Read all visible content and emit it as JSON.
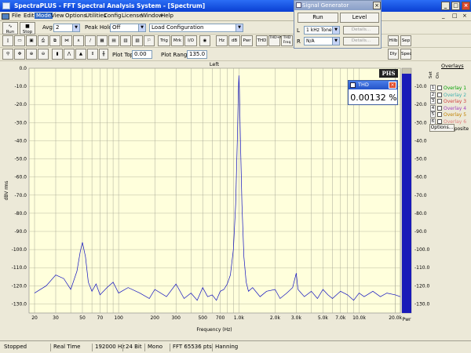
{
  "window": {
    "title": "SpectraPLUS - FFT Spectral Analysis System - [Spectrum]",
    "controls": [
      "_",
      "□",
      "×"
    ]
  },
  "menu": [
    "File",
    "Edit",
    "Mode",
    "View",
    "Options",
    "Utilities",
    "Config",
    "License",
    "Window",
    "Help"
  ],
  "toolbar": {
    "run_label": "Run",
    "stop_label": "Stop",
    "avg_label": "Avg:",
    "avg_value": "2",
    "peak_hold_label": "Peak Hold:",
    "peak_hold_value": "Off",
    "load_config_value": "Load Configuration",
    "buttons_row2": [
      "Trig",
      "Mrk",
      "I/O",
      "Hz",
      "dB",
      "Pwr",
      "THD",
      "THD+N",
      "THD Freq"
    ],
    "plot_top_label": "Plot Top:",
    "plot_top_value": "0.00",
    "plot_range_label": "Plot Range:",
    "plot_range_value": "135.0",
    "right_buttons": [
      "Hilb",
      "Sep"
    ],
    "right_buttons_row2": [
      "Dly",
      "Spec"
    ]
  },
  "signal_generator": {
    "title": "Signal Generator",
    "run_label": "Run",
    "level_label": "Level",
    "left_label": "L",
    "left_value": "1 kHz Tone",
    "right_label": "R",
    "right_value": "N/A",
    "details_label": "Details..."
  },
  "chart_title": "Left",
  "thd": {
    "title": "THD",
    "value": "0.00132 %"
  },
  "phs_label": "PHS",
  "overlays": {
    "title": "Overlays",
    "set_label": "Set",
    "on_label": "On",
    "items": [
      {
        "num": "1",
        "label": "Overlay 1",
        "color": "#00a000"
      },
      {
        "num": "2",
        "label": "Overlay 2",
        "color": "#40b0b0"
      },
      {
        "num": "3",
        "label": "Overlay 3",
        "color": "#d04040"
      },
      {
        "num": "4",
        "label": "Overlay 4",
        "color": "#a040c0"
      },
      {
        "num": "5",
        "label": "Overlay 5",
        "color": "#c08000"
      },
      {
        "num": "6",
        "label": "Overlay 6",
        "color": "#e08080"
      },
      {
        "num": "C",
        "label": "Composite",
        "color": "#000000"
      }
    ],
    "options_label": "Options..."
  },
  "right_scale": [
    "-10.0",
    "-20.0",
    "-30.0",
    "-40.0",
    "-50.0",
    "-60.0",
    "-70.0",
    "-80.0",
    "-90.0",
    "-100.0",
    "-110.0",
    "-120.0",
    "-130.0"
  ],
  "pwr_label": "Pwr",
  "status": [
    "Stopped",
    "Real Time",
    "192000 Hz",
    "24 Bit",
    "Mono",
    "FFT 65536 pts",
    "Hanning"
  ],
  "chart_data": {
    "type": "line",
    "title": "Left",
    "xlabel": "Frequency (Hz)",
    "ylabel": "dBV rms",
    "x_scale": "log",
    "xlim": [
      18,
      22000
    ],
    "ylim": [
      -135,
      0
    ],
    "y_ticks": [
      0,
      -10,
      -20,
      -30,
      -40,
      -50,
      -60,
      -70,
      -80,
      -90,
      -100,
      -110,
      -120,
      -130
    ],
    "y_tick_labels": [
      "0.0",
      "-10.0",
      "-20.0",
      "-30.0",
      "-40.0",
      "-50.0",
      "-60.0",
      "-70.0",
      "-80.0",
      "-90.0",
      "-100.0",
      "-110.0",
      "-120.0",
      "-130.0"
    ],
    "x_tick_labels": [
      {
        "v": 20,
        "t": "20"
      },
      {
        "v": 30,
        "t": "30"
      },
      {
        "v": 50,
        "t": "50"
      },
      {
        "v": 70,
        "t": "70"
      },
      {
        "v": 100,
        "t": "100"
      },
      {
        "v": 200,
        "t": "200"
      },
      {
        "v": 300,
        "t": "300"
      },
      {
        "v": 500,
        "t": "500"
      },
      {
        "v": 700,
        "t": "700"
      },
      {
        "v": 1000,
        "t": "1.0k"
      },
      {
        "v": 2000,
        "t": "2.0k"
      },
      {
        "v": 3000,
        "t": "3.0k"
      },
      {
        "v": 5000,
        "t": "5.0k"
      },
      {
        "v": 7000,
        "t": "7.0k"
      },
      {
        "v": 10000,
        "t": "10.0k"
      },
      {
        "v": 20000,
        "t": "20.0k"
      }
    ],
    "grid": true,
    "line_color": "#1010c0",
    "series": [
      {
        "values": [
          [
            20,
            -124
          ],
          [
            25,
            -120
          ],
          [
            30,
            -114
          ],
          [
            35,
            -116
          ],
          [
            40,
            -122
          ],
          [
            45,
            -112
          ],
          [
            48,
            -101
          ],
          [
            50,
            -96
          ],
          [
            53,
            -104
          ],
          [
            56,
            -118
          ],
          [
            60,
            -123
          ],
          [
            65,
            -119
          ],
          [
            70,
            -125
          ],
          [
            80,
            -121
          ],
          [
            90,
            -118
          ],
          [
            100,
            -124
          ],
          [
            120,
            -121
          ],
          [
            150,
            -124
          ],
          [
            180,
            -127
          ],
          [
            200,
            -122
          ],
          [
            250,
            -126
          ],
          [
            300,
            -119
          ],
          [
            350,
            -127
          ],
          [
            400,
            -124
          ],
          [
            450,
            -128
          ],
          [
            500,
            -121
          ],
          [
            550,
            -126
          ],
          [
            600,
            -125
          ],
          [
            650,
            -128
          ],
          [
            700,
            -123
          ],
          [
            750,
            -122
          ],
          [
            800,
            -119
          ],
          [
            850,
            -114
          ],
          [
            900,
            -100
          ],
          [
            940,
            -75
          ],
          [
            970,
            -40
          ],
          [
            990,
            -12
          ],
          [
            1000,
            -4
          ],
          [
            1010,
            -12
          ],
          [
            1030,
            -40
          ],
          [
            1060,
            -75
          ],
          [
            1100,
            -104
          ],
          [
            1150,
            -118
          ],
          [
            1200,
            -123
          ],
          [
            1300,
            -121
          ],
          [
            1500,
            -126
          ],
          [
            1700,
            -123
          ],
          [
            2000,
            -122
          ],
          [
            2200,
            -127
          ],
          [
            2500,
            -124
          ],
          [
            2800,
            -121
          ],
          [
            3000,
            -113
          ],
          [
            3100,
            -122
          ],
          [
            3500,
            -126
          ],
          [
            4000,
            -123
          ],
          [
            4500,
            -127
          ],
          [
            5000,
            -122
          ],
          [
            5500,
            -125
          ],
          [
            6000,
            -127
          ],
          [
            7000,
            -123
          ],
          [
            8000,
            -125
          ],
          [
            9000,
            -128
          ],
          [
            10000,
            -124
          ],
          [
            11000,
            -126
          ],
          [
            13000,
            -123
          ],
          [
            15000,
            -126
          ],
          [
            17000,
            -124
          ],
          [
            20000,
            -125
          ],
          [
            22000,
            -126
          ]
        ]
      }
    ],
    "pwr_bar_level_db": -3
  }
}
